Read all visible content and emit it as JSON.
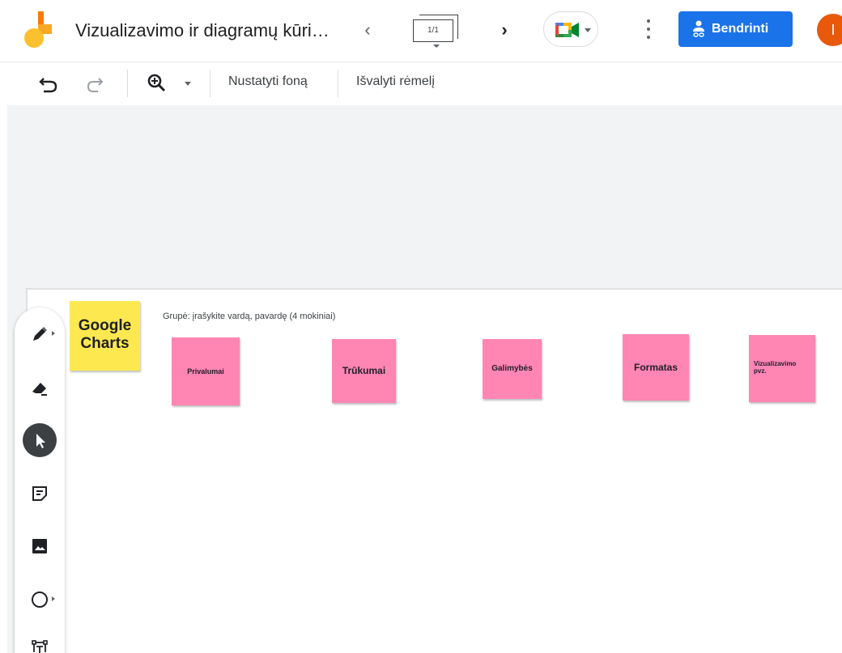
{
  "app": {
    "title": "Vizualizavimo ir diagramų kūri…",
    "frame_counter": "1/1",
    "avatar_initial": "I",
    "accent_color": "#1a73e8"
  },
  "topbar": {
    "prev_icon": "chevron-left-icon",
    "next_icon": "chevron-right-icon",
    "meet_icon": "google-meet-icon",
    "more_icon": "more-vert-icon",
    "share_label": "Bendrinti",
    "share_icon": "person-share-icon"
  },
  "toolbar": {
    "undo_icon": "undo-icon",
    "redo_icon": "redo-icon",
    "zoom_icon": "zoom-in-icon",
    "set_background_label": "Nustatyti foną",
    "clear_frame_label": "Išvalyti rėmelį"
  },
  "canvas": {
    "group_text": "Grupė: įrašykite vardą, pavardę (4 mokiniai)",
    "title_note": {
      "text": "Google Charts",
      "color": "#fde94f"
    },
    "notes": [
      {
        "text": "Privalumai",
        "color": "#ff85b3"
      },
      {
        "text": "Trūkumai",
        "color": "#ff85b3"
      },
      {
        "text": "Galimybės",
        "color": "#ff85b3"
      },
      {
        "text": "Formatas",
        "color": "#ff85b3"
      },
      {
        "text": "Vizualizavimo pvz.",
        "color": "#ff85b3"
      }
    ]
  },
  "tools": [
    {
      "name": "pen-icon"
    },
    {
      "name": "eraser-icon"
    },
    {
      "name": "select-pointer-icon",
      "active": true
    },
    {
      "name": "sticky-note-icon"
    },
    {
      "name": "image-icon"
    },
    {
      "name": "circle-shape-icon"
    },
    {
      "name": "text-box-icon"
    }
  ]
}
